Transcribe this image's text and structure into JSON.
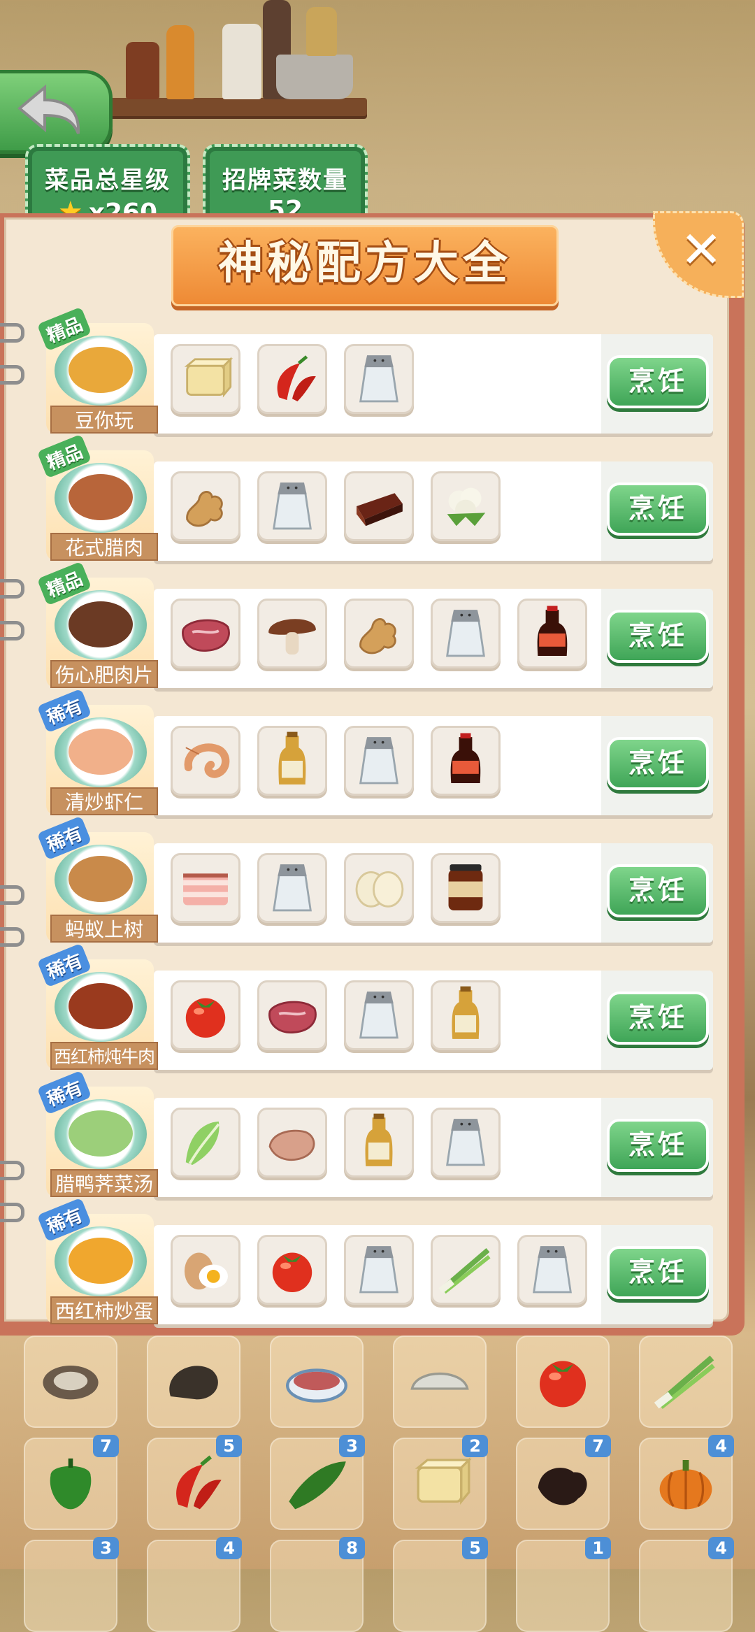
{
  "header": {
    "stats": [
      {
        "label": "菜品总星级",
        "value": "x260",
        "icon": "star-icon"
      },
      {
        "label": "招牌菜数量",
        "value": "52"
      }
    ]
  },
  "panel": {
    "title": "神秘配方大全",
    "close_glyph": "✕"
  },
  "recipes": [
    {
      "name": "豆你玩",
      "badge": "精品",
      "badge_type": "jing",
      "dish_color": "#e9a83a",
      "ingredients": [
        "tofu",
        "chili",
        "salt"
      ],
      "cook_label": "烹饪"
    },
    {
      "name": "花式腊肉",
      "badge": "精品",
      "badge_type": "jing",
      "dish_color": "#b8653a",
      "ingredients": [
        "ginger",
        "salt",
        "cured-meat",
        "cauliflower"
      ],
      "cook_label": "烹饪"
    },
    {
      "name": "伤心肥肉片",
      "badge": "精品",
      "badge_type": "jing",
      "dish_color": "#6b3a24",
      "ingredients": [
        "raw-beef",
        "mushroom",
        "ginger",
        "salt",
        "soy-sauce"
      ],
      "cook_label": "烹饪"
    },
    {
      "name": "清炒虾仁",
      "badge": "稀有",
      "badge_type": "xi",
      "dish_color": "#f1b08a",
      "ingredients": [
        "shrimp",
        "cooking-wine",
        "salt",
        "soy-sauce"
      ],
      "cook_label": "烹饪"
    },
    {
      "name": "蚂蚁上树",
      "badge": "稀有",
      "badge_type": "xi",
      "dish_color": "#c98a4a",
      "ingredients": [
        "pork-belly",
        "salt",
        "rice-noodles",
        "bean-paste"
      ],
      "cook_label": "烹饪"
    },
    {
      "name": "西红柿炖牛肉",
      "badge": "稀有",
      "badge_type": "xi",
      "dish_color": "#9a3a1e",
      "ingredients": [
        "tomato",
        "raw-beef",
        "salt",
        "cooking-wine"
      ],
      "cook_label": "烹饪"
    },
    {
      "name": "腊鸭荠菜汤",
      "badge": "稀有",
      "badge_type": "xi",
      "dish_color": "#9ccf7a",
      "ingredients": [
        "greens",
        "duck",
        "cooking-wine",
        "salt"
      ],
      "cook_label": "烹饪"
    },
    {
      "name": "西红柿炒蛋",
      "badge": "稀有",
      "badge_type": "xi",
      "dish_color": "#f0a72e",
      "ingredients": [
        "egg",
        "tomato",
        "salt",
        "scallion",
        "salt"
      ],
      "cook_label": "烹饪"
    }
  ],
  "inventory": {
    "row1": [
      {
        "item": "oyster"
      },
      {
        "item": "snail"
      },
      {
        "item": "minced-meat"
      },
      {
        "item": "dumpling"
      },
      {
        "item": "tomato"
      },
      {
        "item": "scallion"
      }
    ],
    "row2": [
      {
        "item": "green-pepper",
        "count": "7"
      },
      {
        "item": "chili",
        "count": "5"
      },
      {
        "item": "cucumber",
        "count": "3"
      },
      {
        "item": "tofu",
        "count": "2"
      },
      {
        "item": "wood-ear",
        "count": "7"
      },
      {
        "item": "pumpkin",
        "count": "4"
      }
    ],
    "row3": [
      {
        "count": "3"
      },
      {
        "count": "4"
      },
      {
        "count": "8"
      },
      {
        "count": "5"
      },
      {
        "count": "1"
      },
      {
        "count": "4"
      }
    ]
  },
  "colors": {
    "green": "#3fa557",
    "orange": "#ee8a35",
    "panel_bg": "#f4e7d3",
    "blue_badge": "#4a8fe0"
  }
}
